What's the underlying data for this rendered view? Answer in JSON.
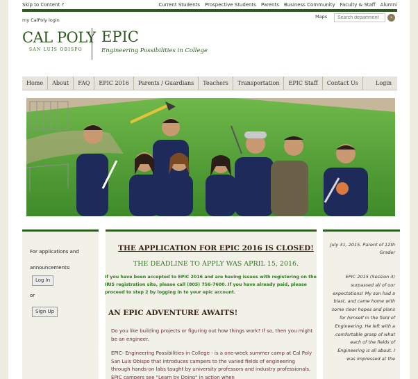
{
  "utility": {
    "skip": "Skip to Content",
    "skip_icon": "?",
    "links": [
      "Current Students",
      "Prospective Students",
      "Parents",
      "Business Community",
      "Faculty & Staff",
      "Alumni"
    ]
  },
  "my_login": "my CalPoly login",
  "maps": "Maps",
  "search": {
    "placeholder": "Search department",
    "button_icon": "›"
  },
  "logo": {
    "big": "CAL POLY",
    "small": "SAN LUIS OBISPO"
  },
  "site": {
    "title": "EPIC",
    "subtitle": "Engineering Possibilities in College"
  },
  "nav": {
    "items": [
      "Home",
      "About",
      "FAQ",
      "EPIC 2016",
      "Parents / Guardians",
      "Teachers",
      "Transportation",
      "EPIC Staff",
      "Contact Us"
    ],
    "login": "Login"
  },
  "sidebar": {
    "heading1": "For applications and",
    "heading2": "announcements:",
    "login_btn": "Log In",
    "or": "or",
    "signup_btn": "Sign Up"
  },
  "main": {
    "closed_title": "THE APPLICATION FOR EPIC 2016 IS CLOSED!",
    "deadline": "THE DEADLINE TO APPLY WAS APRIL 15, 2016.",
    "accepted": "If you have been accepted to EPIC 2016 and are having issues with registering on the IRIS registration site, please call (805) 756-7600.  If you have already paid, please proceed to step 2 by logging in to your epic account.",
    "adventure": "AN EPIC ADVENTURE AWAITS!",
    "para1": "Do you like building projects or figuring out how things work?  If so, then you might be an engineer.",
    "para2": "EPIC- Engineering Possibilities in College - is a one-week summer camp at Cal Poly San Luis Obispo that introduces campers to the varied fields of engineering through hands-on labs taught by university professors and industry professionals.  EPIC campers see \"Learn by Doing\" in action when"
  },
  "testimonial": {
    "date": "July 31, 2015, Parent of 12th Grader",
    "quote": "EPIC 2015 (Session 3) surpassed all of our expectations! My son had a blast, and came home with some clear hopes and plans for himself in the field of Engineering. He left with a comfortable grasp of what each of the fields of Engineering is all about. I was impressed at the"
  },
  "colors": {
    "brand_green": "#2d5a1e",
    "headline_brown": "#3a1f12",
    "notice_green": "#2d7a1e",
    "body_maroon": "#6a2a3a"
  }
}
